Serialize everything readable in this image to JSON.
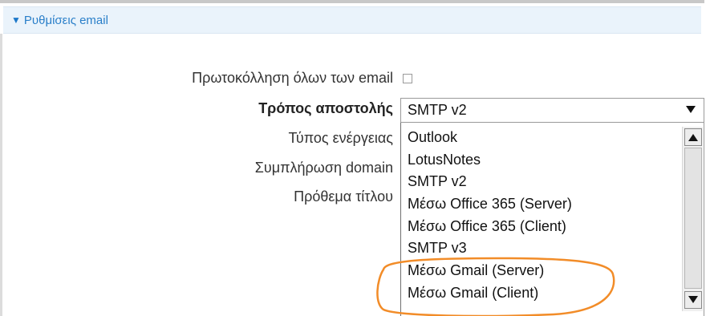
{
  "section": {
    "title": "Ρυθμίσεις email",
    "toggle_icon": "triangle-down-icon"
  },
  "form": {
    "labels": {
      "protocol_all": "Πρωτοκόλληση όλων των email",
      "send_method": "Τρόπος αποστολής",
      "action_type": "Τύπος ενέργειας",
      "domain_fill": "Συμπλήρωση domain",
      "title_prefix": "Πρόθεμα τίτλου"
    },
    "protocol_all_checked": false
  },
  "send_method_select": {
    "selected": "SMTP v2",
    "options": [
      "Outlook",
      "LotusNotes",
      "SMTP v2",
      "Μέσω Office 365 (Server)",
      "Μέσω Office 365 (Client)",
      "SMTP v3",
      "Μέσω Gmail (Server)",
      "Μέσω Gmail (Client)"
    ]
  },
  "annotation": {
    "color": "#f28c28"
  }
}
